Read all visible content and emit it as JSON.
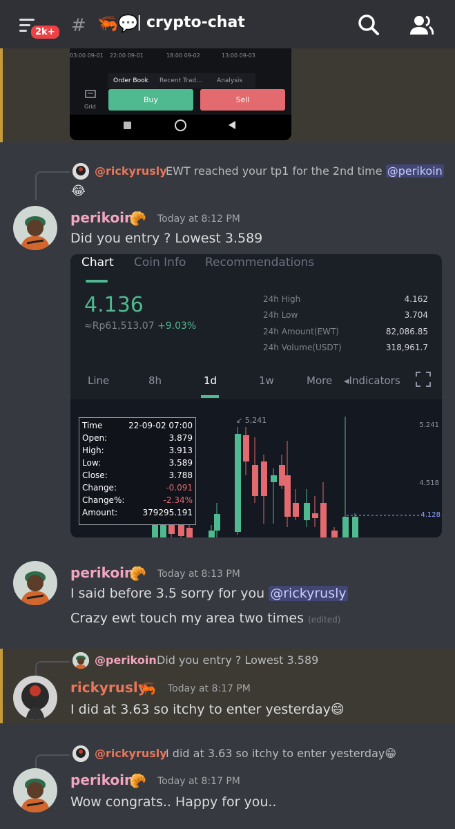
{
  "header": {
    "title": "crypto-chat",
    "badge": "2k+",
    "channel_emojis": "🦐💬"
  },
  "snapshot": {
    "time_ticks": [
      "03:00 09-01",
      "22:00 09-01",
      "18:00 09-02",
      "13:00 09-03"
    ],
    "tabs": [
      "Order Book",
      "Recent Trad...",
      "Analysis"
    ],
    "grid_label": "Grid",
    "buy": "Buy",
    "sell": "Sell"
  },
  "messages": [
    {
      "reply": {
        "name": "@rickyrusly",
        "text": "EWT reached your tp1 for the 2nd time",
        "mention": "@perikoin",
        "emoji": "😂"
      },
      "user": "perikoin",
      "badge": "🥐",
      "time": "Today at 8:12 PM",
      "lines": [
        "Did you entry ? Lowest 3.589"
      ]
    },
    {
      "user": "perikoin",
      "badge": "🥐",
      "time": "Today at 8:13 PM",
      "line1": "I said before 3.5 sorry for you",
      "mention": "@rickyrusly",
      "line2": "Crazy ewt touch my area two times",
      "edited": "(edited)"
    },
    {
      "reply": {
        "name": "@perikoin",
        "text": "Did you entry ? Lowest 3.589"
      },
      "user": "rickyrusly",
      "badge": "🦐",
      "time": "Today at 8:17 PM",
      "text": "I did at 3.63 so itchy to enter yesterday😄"
    },
    {
      "reply": {
        "name": "@rickyrusly",
        "text": "I did at 3.63 so itchy to enter yesterday😁"
      },
      "user": "perikoin",
      "badge": "🥐",
      "time": "Today at 8:17 PM",
      "text": "Wow congrats.. Happy for you.."
    }
  ],
  "card": {
    "tabs": [
      "Chart",
      "Coin Info",
      "Recommendations"
    ],
    "price": "4.136",
    "idr": "≈Rp61,513.07",
    "pct": "+9.03%",
    "stats": [
      {
        "k": "24h High",
        "v": "4.162"
      },
      {
        "k": "24h Low",
        "v": "3.704"
      },
      {
        "k": "24h Amount(EWT)",
        "v": "82,086.85"
      },
      {
        "k": "24h Volume(USDT)",
        "v": "318,961.7"
      }
    ],
    "intervals": [
      "Line",
      "8h",
      "1d",
      "1w",
      "More",
      "◂Indicators"
    ],
    "tooltip": [
      {
        "k": "Time",
        "v": "22-09-02 07:00"
      },
      {
        "k": "Open:",
        "v": "3.879"
      },
      {
        "k": "High:",
        "v": "3.913"
      },
      {
        "k": "Low:",
        "v": "3.589"
      },
      {
        "k": "Close:",
        "v": "3.788"
      },
      {
        "k": "Change:",
        "v": "-0.091"
      },
      {
        "k": "Change%:",
        "v": "-2.34%"
      },
      {
        "k": "Amount:",
        "v": "379295.191"
      }
    ],
    "high_marker": "↙ 5,241",
    "price_axis": [
      "5.241",
      "4.518",
      "4.128"
    ]
  },
  "colors": {
    "bg": "#36393f",
    "header": "#2f3136",
    "highlight": "#3c3a33",
    "highlight_bar": "#c69a3b",
    "green": "#4fb98f",
    "red": "#e36a6e",
    "mention": "#414675",
    "perikoin": "#f3a5c0",
    "rickyrusly": "#e8765b"
  }
}
